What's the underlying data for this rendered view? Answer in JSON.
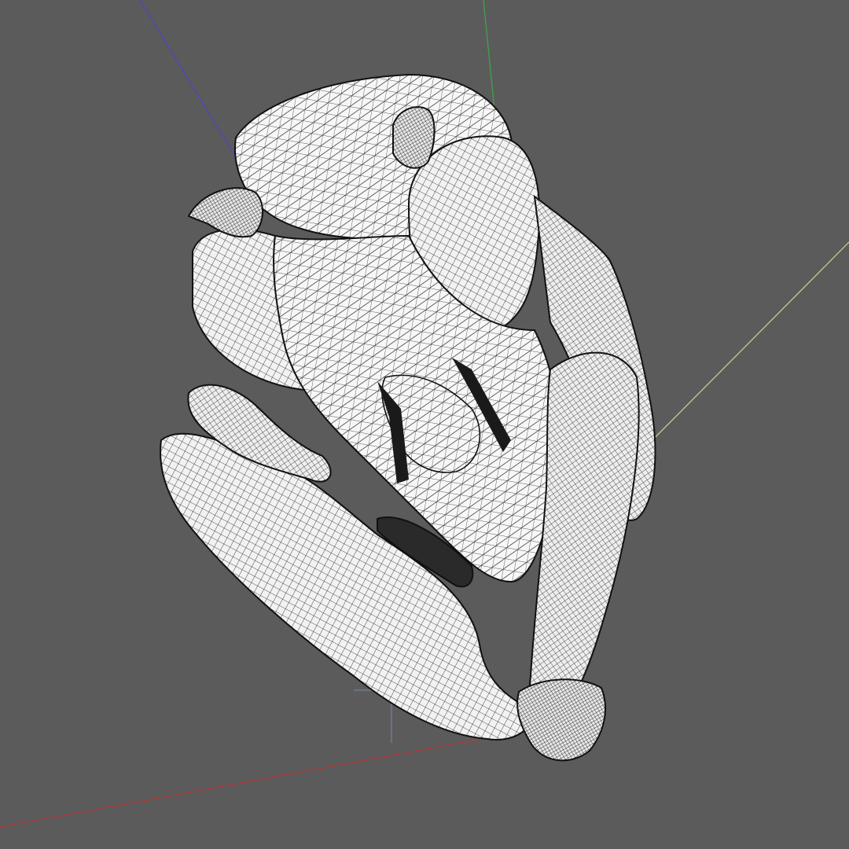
{
  "viewport": {
    "background": "#5b5b5b",
    "render_mode": "wireframe-on-shaded",
    "mesh_fill": "#f4f4f4",
    "wire_color": "#1a1a1a"
  },
  "axes": {
    "x_color": "#b03a3a",
    "y_color": "#3fa34a",
    "z_color": "#4a4ab8",
    "w_color": "#c8c890"
  },
  "model": {
    "icon": "animal-skull-mesh"
  }
}
